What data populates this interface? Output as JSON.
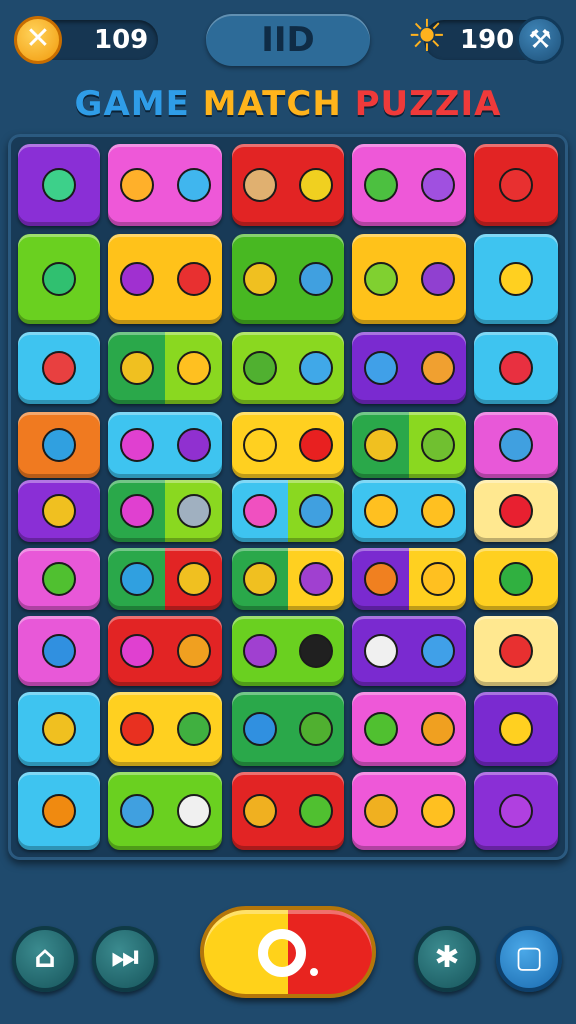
{
  "hud": {
    "left_value": "109",
    "center_label": "IID",
    "right_value": "190"
  },
  "title": {
    "word1": "GAME",
    "word2": "MATCH",
    "word3": "PUZZIA"
  },
  "icons": {
    "close": "close-icon",
    "sun": "sun-icon",
    "hammer": "hammer-icon",
    "home": "home-icon",
    "skip": "skip-icon",
    "puzzle": "puzzle-icon",
    "stop": "stop-icon"
  },
  "board": {
    "rows": [
      [
        {
          "colors": [
            "#8a2fd6"
          ],
          "icons": [
            "#3dd08a"
          ]
        },
        {
          "colors": [
            "#ee58d8"
          ],
          "icons": [
            "#ffb02a",
            "#40b6ee"
          ]
        },
        {
          "colors": [
            "#e22424"
          ],
          "icons": [
            "#e0b070",
            "#f0d020"
          ]
        },
        {
          "colors": [
            "#ee58d8"
          ],
          "icons": [
            "#4cc040",
            "#a050e0"
          ]
        },
        {
          "colors": [
            "#e22424"
          ],
          "icons": [
            "#e83030"
          ]
        }
      ],
      [
        {
          "colors": [
            "#6ad020"
          ],
          "icons": [
            "#30c070"
          ]
        },
        {
          "colors": [
            "#ffc21a"
          ],
          "icons": [
            "#a030d0",
            "#e83030"
          ]
        },
        {
          "colors": [
            "#48b822"
          ],
          "icons": [
            "#f0c020",
            "#40a0e0"
          ]
        },
        {
          "colors": [
            "#ffc21a"
          ],
          "icons": [
            "#80d030",
            "#9040d0"
          ]
        },
        {
          "colors": [
            "#3ec4f0"
          ],
          "icons": [
            "#ffd020"
          ]
        }
      ],
      [
        {
          "colors": [
            "#3ec4f0"
          ],
          "icons": [
            "#e84040"
          ]
        },
        {
          "colors": [
            "#2aa84a",
            "#8ad820"
          ],
          "icons": [
            "#f0c020",
            "#ffc020"
          ]
        },
        {
          "colors": [
            "#8ad820"
          ],
          "icons": [
            "#50b030",
            "#40a8e8"
          ]
        },
        {
          "colors": [
            "#7a2ad0"
          ],
          "icons": [
            "#40a0e8",
            "#f0a030"
          ]
        },
        {
          "colors": [
            "#3ec4f0"
          ],
          "icons": [
            "#e83040"
          ]
        }
      ],
      [
        {
          "colors": [
            "#f07a20"
          ],
          "icons": [
            "#30a0e0"
          ]
        },
        {
          "colors": [
            "#3ec4f0"
          ],
          "icons": [
            "#e040d0",
            "#9030d0"
          ]
        },
        {
          "colors": [
            "#ffd020",
            "#ffd020"
          ],
          "icons": [
            "#ffd020",
            "#e82020"
          ]
        },
        {
          "colors": [
            "#2aa84a",
            "#8ad820"
          ],
          "icons": [
            "#f0c020",
            "#70c030"
          ]
        },
        {
          "colors": [
            "#e858d8"
          ],
          "icons": [
            "#40a0e0"
          ]
        }
      ],
      [
        {
          "colors": [
            "#8a2fd6"
          ],
          "icons": [
            "#f0c020"
          ]
        },
        {
          "colors": [
            "#2aa84a",
            "#8ad820"
          ],
          "icons": [
            "#e040d0",
            "#a0b0c0"
          ]
        },
        {
          "colors": [
            "#3ec4f0",
            "#8ad820"
          ],
          "icons": [
            "#f050c0",
            "#40a0e0"
          ]
        },
        {
          "colors": [
            "#3ec4f0"
          ],
          "icons": [
            "#ffc020",
            "#ffc020"
          ]
        },
        {
          "colors": [
            "#ffe890"
          ],
          "icons": [
            "#e82030"
          ]
        }
      ],
      [
        {
          "colors": [
            "#e858d8"
          ],
          "icons": [
            "#50c030"
          ]
        },
        {
          "colors": [
            "#2aa84a",
            "#e22424"
          ],
          "icons": [
            "#30a0e0",
            "#f0c020"
          ]
        },
        {
          "colors": [
            "#2aa84a",
            "#ffd020"
          ],
          "icons": [
            "#f0c020",
            "#a040d0"
          ]
        },
        {
          "colors": [
            "#7a2ad0",
            "#ffd020"
          ],
          "icons": [
            "#f08020",
            "#ffc020"
          ]
        },
        {
          "colors": [
            "#ffd020"
          ],
          "icons": [
            "#30b040"
          ]
        }
      ],
      [
        {
          "colors": [
            "#e858d8"
          ],
          "icons": [
            "#3090e0"
          ]
        },
        {
          "colors": [
            "#e22424"
          ],
          "icons": [
            "#e040d0",
            "#f0a020"
          ]
        },
        {
          "colors": [
            "#6ad020"
          ],
          "icons": [
            "#a040d0",
            "#202020"
          ]
        },
        {
          "colors": [
            "#7a2ad0"
          ],
          "icons": [
            "#f0f0f0",
            "#40a0e8"
          ]
        },
        {
          "colors": [
            "#ffe890"
          ],
          "icons": [
            "#e83030"
          ]
        }
      ],
      [
        {
          "colors": [
            "#3ec4f0"
          ],
          "icons": [
            "#f0c020"
          ]
        },
        {
          "colors": [
            "#ffd020"
          ],
          "icons": [
            "#e83020",
            "#40b040"
          ]
        },
        {
          "colors": [
            "#2aa84a"
          ],
          "icons": [
            "#3090e0",
            "#50b030"
          ]
        },
        {
          "colors": [
            "#ee58d8"
          ],
          "icons": [
            "#50c030",
            "#f0a020"
          ]
        },
        {
          "colors": [
            "#7a2ad0"
          ],
          "icons": [
            "#ffd020"
          ]
        }
      ],
      [
        {
          "colors": [
            "#3ec4f0"
          ],
          "icons": [
            "#f08a10"
          ]
        },
        {
          "colors": [
            "#6ad020"
          ],
          "icons": [
            "#40a0e0",
            "#f0f0f0"
          ]
        },
        {
          "colors": [
            "#e22424"
          ],
          "icons": [
            "#f0b020",
            "#50c030"
          ]
        },
        {
          "colors": [
            "#ee58d8"
          ],
          "icons": [
            "#f0b020",
            "#ffc020"
          ]
        },
        {
          "colors": [
            "#8a2fd6"
          ],
          "icons": [
            "#b040e0"
          ]
        }
      ]
    ]
  }
}
